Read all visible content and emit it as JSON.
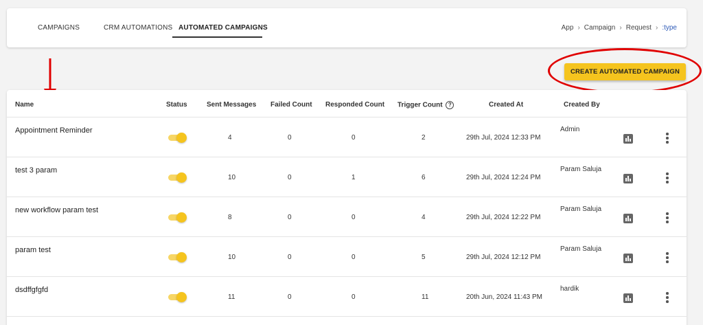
{
  "tabs": [
    {
      "label": "CAMPAIGNS",
      "active": false
    },
    {
      "label": "CRM AUTOMATIONS",
      "active": false
    },
    {
      "label": "AUTOMATED CAMPAIGNS",
      "active": true
    }
  ],
  "breadcrumb": [
    "App",
    "Campaign",
    "Request",
    ":type"
  ],
  "create_button": "CREATE AUTOMATED CAMPAIGN",
  "columns": [
    "Name",
    "Status",
    "Sent Messages",
    "Failed Count",
    "Responded Count",
    "Trigger Count",
    "Created At",
    "Created By"
  ],
  "icons": {
    "help": "help-circle-icon",
    "chart": "bar-chart-icon",
    "more": "more-vertical-icon",
    "annotation": "red-arrow-down"
  },
  "colors": {
    "accent": "#f5c41e",
    "highlight": "#e00000"
  },
  "rows": [
    {
      "name": "Appointment Reminder",
      "status": "on",
      "sent": "4",
      "failed": "0",
      "responded": "0",
      "trigger": "2",
      "created_at": "29th Jul, 2024 12:33 PM",
      "created_by": "Admin"
    },
    {
      "name": "test 3 param",
      "status": "on",
      "sent": "10",
      "failed": "0",
      "responded": "1",
      "trigger": "6",
      "created_at": "29th Jul, 2024 12:24 PM",
      "created_by": "Param Saluja"
    },
    {
      "name": "new workflow param test",
      "status": "on",
      "sent": "8",
      "failed": "0",
      "responded": "0",
      "trigger": "4",
      "created_at": "29th Jul, 2024 12:22 PM",
      "created_by": "Param Saluja"
    },
    {
      "name": "param test",
      "status": "on",
      "sent": "10",
      "failed": "0",
      "responded": "0",
      "trigger": "5",
      "created_at": "29th Jul, 2024 12:12 PM",
      "created_by": "Param Saluja"
    },
    {
      "name": "dsdffgfgfd",
      "status": "on",
      "sent": "11",
      "failed": "0",
      "responded": "0",
      "trigger": "11",
      "created_at": "20th Jun, 2024 11:43 PM",
      "created_by": "hardik"
    }
  ]
}
